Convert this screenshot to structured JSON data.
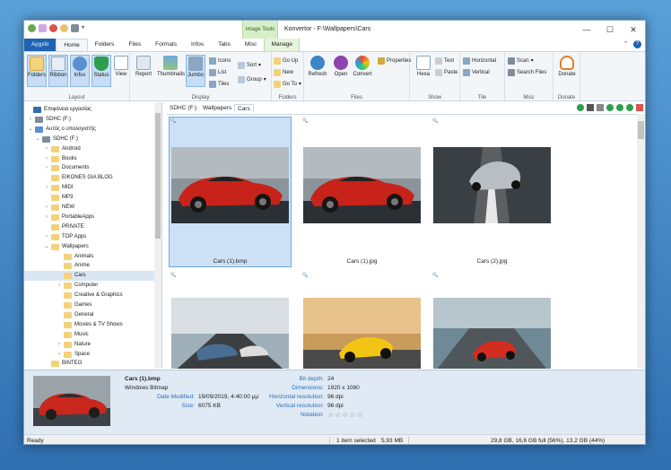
{
  "window": {
    "title": "Konvertor - F:\\Wallpapers\\Cars",
    "context_tab_header": "Image Tools",
    "controls": [
      "—",
      "☐",
      "✕"
    ]
  },
  "tabs": [
    "Αρχείο",
    "Home",
    "Folders",
    "Files",
    "Formats",
    "Infos",
    "Tabs",
    "Misc",
    "Manage"
  ],
  "ribbon": {
    "layout": {
      "label": "Layout",
      "buttons": [
        "Folders",
        "Ribbon",
        "Infos",
        "Status"
      ]
    },
    "display": {
      "label": "Display",
      "buttons": [
        "View",
        "Report",
        "Thumbnails",
        "Jumbo"
      ],
      "small": [
        "Icons",
        "List",
        "Tiles",
        "Sort",
        "Group"
      ]
    },
    "folders": {
      "label": "Folders",
      "small": [
        "Go Up",
        "New",
        "Go To"
      ]
    },
    "files": {
      "label": "Files",
      "buttons": [
        "Refresh",
        "Open",
        "Convert"
      ],
      "small": [
        "Properties"
      ]
    },
    "show": {
      "label": "Show",
      "buttons": [
        "Hexa"
      ],
      "small": [
        "Text",
        "Paste"
      ]
    },
    "tile": {
      "label": "Tile",
      "small": [
        "Horizontal",
        "Vertical"
      ]
    },
    "misc": {
      "label": "Misc",
      "small": [
        "Scan",
        "Search Files"
      ]
    },
    "donate": {
      "label": "Donate",
      "buttons": [
        "Donate"
      ]
    }
  },
  "tree": {
    "items": [
      {
        "label": "Επιφάνεια εργασίας",
        "level": 0,
        "arrow": "",
        "icon": "desktop"
      },
      {
        "label": "SDHC (F:)",
        "level": 1,
        "arrow": "›",
        "icon": "drive"
      },
      {
        "label": "Αυτός ο υπολογιστής",
        "level": 1,
        "arrow": "⌄",
        "icon": "computer"
      },
      {
        "label": "SDHC (F:)",
        "level": 2,
        "arrow": "⌄",
        "icon": "drive"
      },
      {
        "label": "Android",
        "level": 3,
        "arrow": "›",
        "icon": "folder"
      },
      {
        "label": "Books",
        "level": 3,
        "arrow": "›",
        "icon": "folder"
      },
      {
        "label": "Documents",
        "level": 3,
        "arrow": "›",
        "icon": "folder"
      },
      {
        "label": "EIKONES GIA BLOG",
        "level": 3,
        "arrow": "",
        "icon": "folder"
      },
      {
        "label": "MIDI",
        "level": 3,
        "arrow": "›",
        "icon": "folder"
      },
      {
        "label": "MP3",
        "level": 3,
        "arrow": "",
        "icon": "folder"
      },
      {
        "label": "NEW",
        "level": 3,
        "arrow": "›",
        "icon": "folder"
      },
      {
        "label": "PortableApps",
        "level": 3,
        "arrow": "›",
        "icon": "folder"
      },
      {
        "label": "PRIVATE",
        "level": 3,
        "arrow": "",
        "icon": "folder"
      },
      {
        "label": "TOP Apps",
        "level": 3,
        "arrow": "›",
        "icon": "folder"
      },
      {
        "label": "Wallpapers",
        "level": 3,
        "arrow": "⌄",
        "icon": "folder"
      },
      {
        "label": "Animals",
        "level": 4,
        "arrow": "",
        "icon": "folder"
      },
      {
        "label": "Anime",
        "level": 4,
        "arrow": "",
        "icon": "folder"
      },
      {
        "label": "Cars",
        "level": 4,
        "arrow": "",
        "icon": "folder",
        "selected": true
      },
      {
        "label": "Computer",
        "level": 4,
        "arrow": "›",
        "icon": "folder"
      },
      {
        "label": "Creative & Graphics",
        "level": 4,
        "arrow": "",
        "icon": "folder"
      },
      {
        "label": "Games",
        "level": 4,
        "arrow": "",
        "icon": "folder"
      },
      {
        "label": "General",
        "level": 4,
        "arrow": "",
        "icon": "folder"
      },
      {
        "label": "Movies & TV Shows",
        "level": 4,
        "arrow": "",
        "icon": "folder"
      },
      {
        "label": "Music",
        "level": 4,
        "arrow": "",
        "icon": "folder"
      },
      {
        "label": "Nature",
        "level": 4,
        "arrow": "›",
        "icon": "folder"
      },
      {
        "label": "Space",
        "level": 4,
        "arrow": "›",
        "icon": "folder"
      },
      {
        "label": "BINTEO",
        "level": 3,
        "arrow": "",
        "icon": "folder"
      }
    ]
  },
  "pathbar": {
    "crumbs": [
      "SDHC (F:)",
      "Wallpapers",
      "Cars"
    ]
  },
  "thumbnails": [
    {
      "label": "Cars (1).bmp",
      "selected": true,
      "scene": "red-car"
    },
    {
      "label": "Cars (1).jpg",
      "selected": false,
      "scene": "red-car"
    },
    {
      "label": "Cars (2).jpg",
      "selected": false,
      "scene": "silver-car"
    },
    {
      "label": "",
      "selected": false,
      "scene": "road-cars"
    },
    {
      "label": "",
      "selected": false,
      "scene": "yellow-car"
    },
    {
      "label": "",
      "selected": false,
      "scene": "red-road"
    }
  ],
  "details": {
    "filename": "Cars (1).bmp",
    "type": "Windows Bitmap",
    "date_label": "Date Modified:",
    "date_value": "19/09/2019, 4:40:00 μμ",
    "size_label": "Size:",
    "size_value": "6075 KB",
    "bitdepth_label": "Bit depth:",
    "bitdepth_value": "24",
    "dimensions_label": "Dimensions:",
    "dimensions_value": "1920 x 1080",
    "hres_label": "Horizontal resolution:",
    "hres_value": "96 dpi",
    "vres_label": "Vertical resolution:",
    "vres_value": "96 dpi",
    "notation_label": "Notation:",
    "notation_stars": "☆☆☆☆☆"
  },
  "status": {
    "left": "Ready",
    "selected": "1 item selected",
    "size": "5,93 MB",
    "disk": "29,8 GB,  16,6 GB full (56%),  13,2 GB  (44%)"
  },
  "colors": {
    "app_tab": "#1f63b3",
    "context_green": "#d7efc9",
    "selection": "#cde1f6"
  }
}
